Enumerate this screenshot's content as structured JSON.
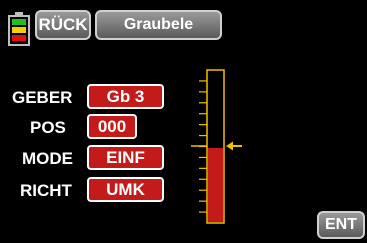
{
  "header": {
    "back_label": "RÜCK",
    "title": "Graubele"
  },
  "rows": [
    {
      "label": "GEBER",
      "value": "Gb 3"
    },
    {
      "label": "POS",
      "value": "000"
    },
    {
      "label": "MODE",
      "value": "EINF"
    },
    {
      "label": "RICHT",
      "value": "UMK"
    }
  ],
  "footer": {
    "ent_label": "ENT"
  },
  "gauge": {
    "fill_fraction": 0.49
  },
  "battery": {
    "level": 0.75
  },
  "colors": {
    "accent": "#f0c000",
    "value_bg": "#c31a1a",
    "fill": "#c31a1a"
  }
}
